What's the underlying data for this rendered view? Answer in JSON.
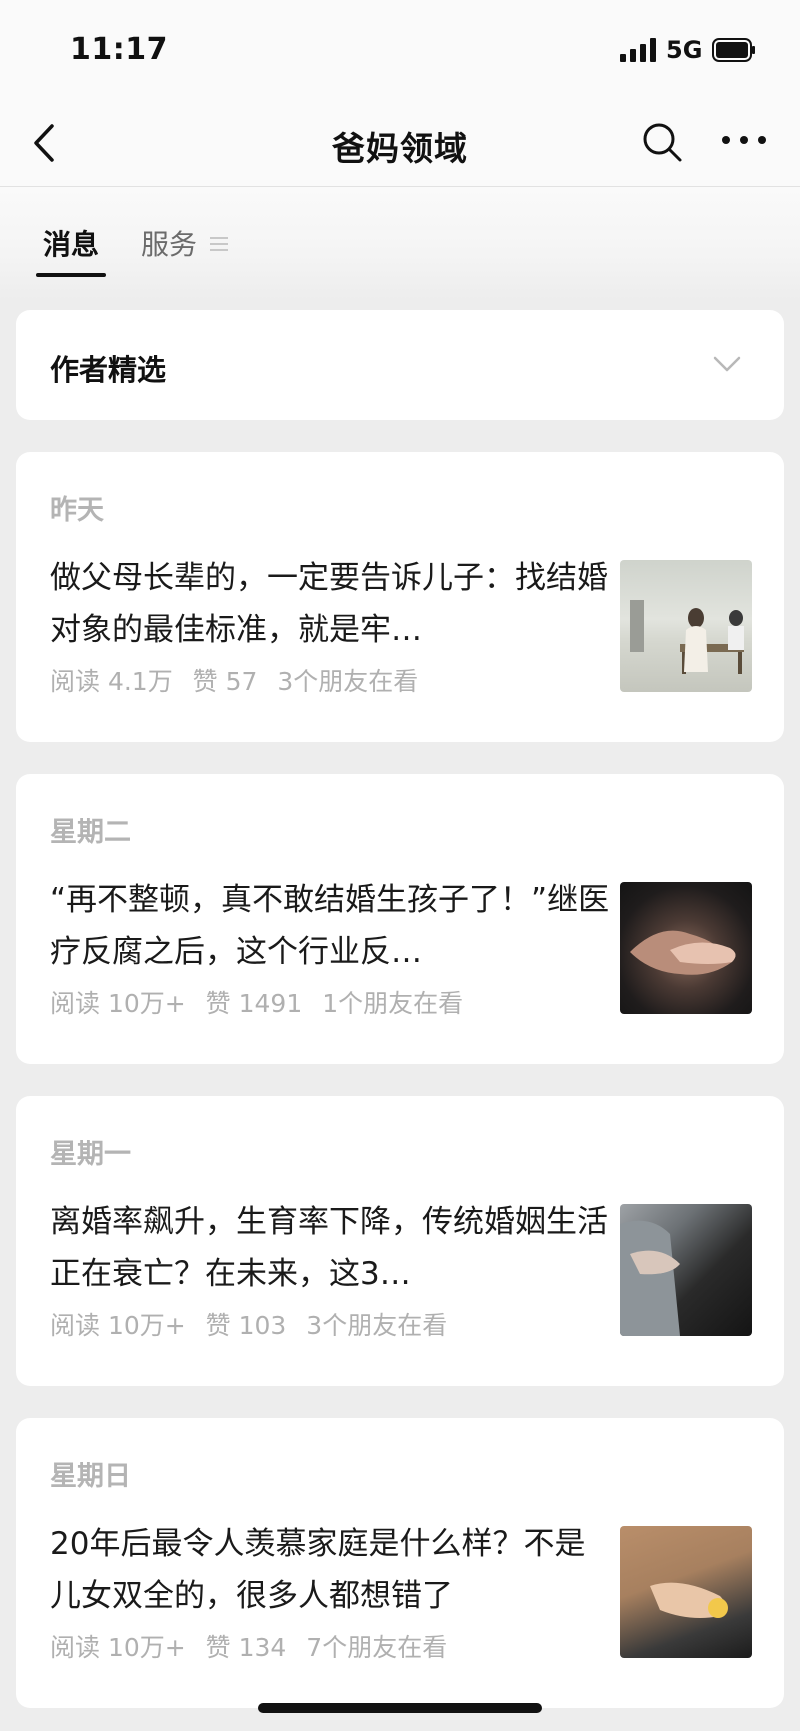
{
  "status_bar": {
    "time": "11:17",
    "network": "5G",
    "icons": [
      "signal-icon",
      "battery-icon"
    ]
  },
  "navbar": {
    "title": "爸妈领域",
    "icons": [
      "back-icon",
      "search-icon",
      "more-icon"
    ]
  },
  "tabs": [
    {
      "label": "消息",
      "active": true
    },
    {
      "label": "服务",
      "active": false,
      "icon": "menu-lines-icon"
    }
  ],
  "selection": {
    "title": "作者精选",
    "icon": "chevron-down-icon"
  },
  "articles": [
    {
      "date": "昨天",
      "title": "做父母长辈的，一定要告诉儿子：找结婚对象的最佳标准，就是牢…",
      "reads": "阅读 4.1万",
      "likes": "赞 57",
      "friends": "3个朋友在看",
      "thumbnail": "thumbnail-image"
    },
    {
      "date": "星期二",
      "title": "“再不整顿，真不敢结婚生孩子了！”继医疗反腐之后，这个行业反…",
      "reads": "阅读 10万+",
      "likes": "赞 1491",
      "friends": "1个朋友在看",
      "thumbnail": "thumbnail-image"
    },
    {
      "date": "星期一",
      "title": "离婚率飙升，生育率下降，传统婚姻生活正在衰亡？在未来，这3…",
      "reads": "阅读 10万+",
      "likes": "赞 103",
      "friends": "3个朋友在看",
      "thumbnail": "thumbnail-image"
    },
    {
      "date": "星期日",
      "title": "20年后最令人羡慕家庭是什么样？不是儿女双全的，很多人都想错了",
      "reads": "阅读 10万+",
      "likes": "赞 134",
      "friends": "7个朋友在看",
      "thumbnail": "thumbnail-image"
    }
  ]
}
